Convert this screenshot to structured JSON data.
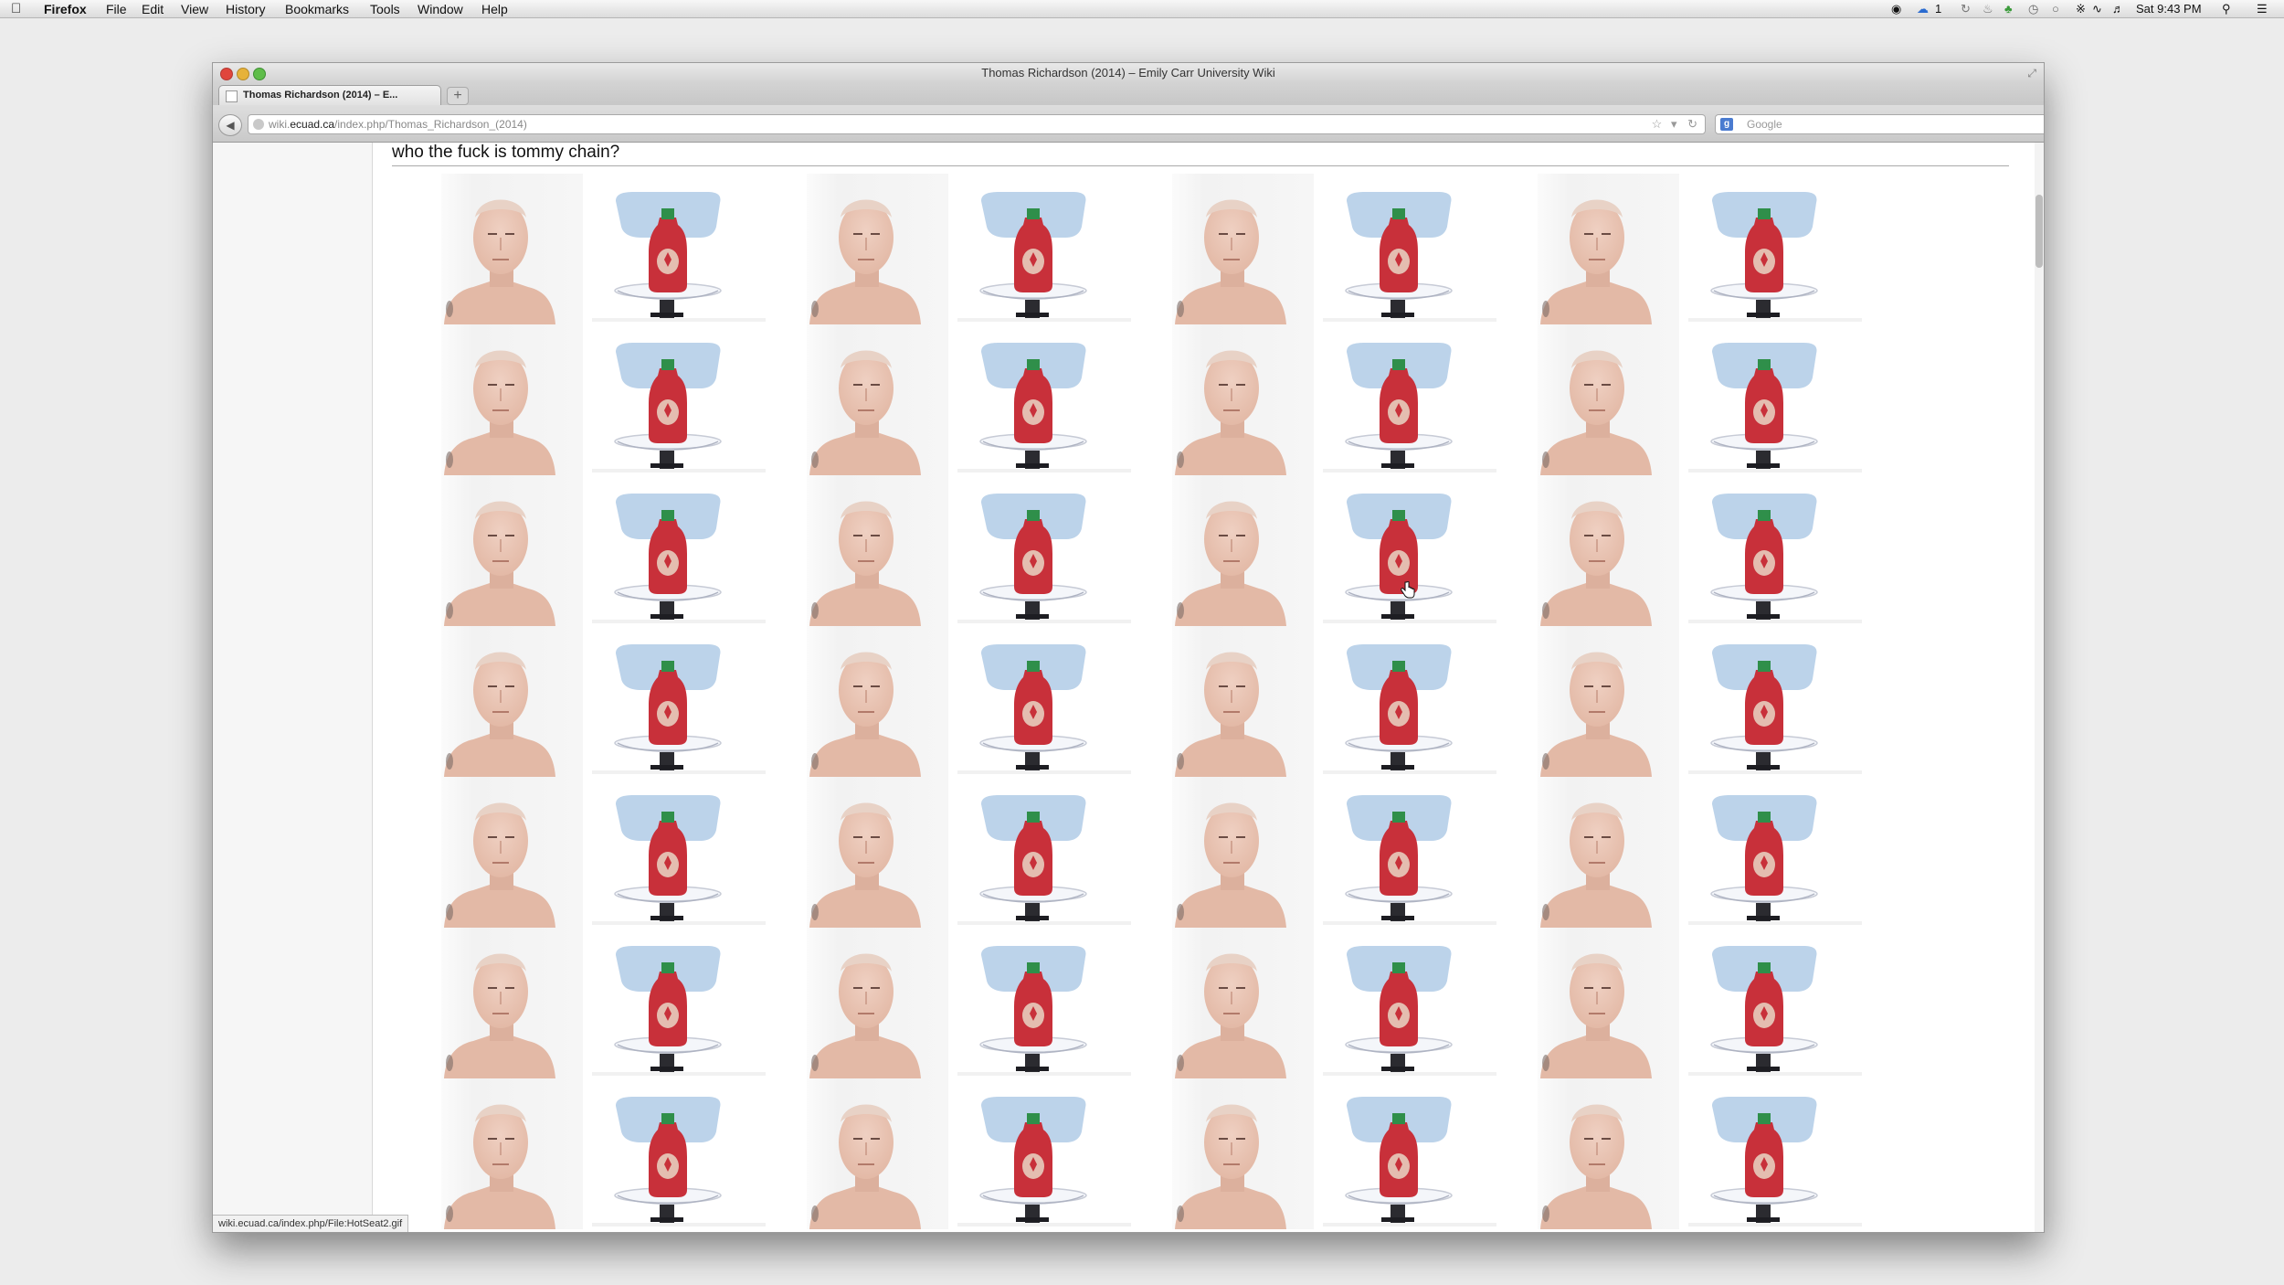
{
  "menubar": {
    "app_name": "Firefox",
    "items": [
      "File",
      "Edit",
      "View",
      "History",
      "Bookmarks",
      "Tools",
      "Window",
      "Help"
    ],
    "badge_count": "1",
    "clock": "Sat 9:43 PM"
  },
  "window": {
    "title": "Thomas Richardson (2014) – Emily Carr University Wiki"
  },
  "tab": {
    "label": "Thomas Richardson (2014) – E..."
  },
  "navbar": {
    "url_prefix": "wiki.",
    "url_host": "ecuad.ca",
    "url_path": "/index.php/Thomas_Richardson_(2014)",
    "search_placeholder": "Google"
  },
  "page": {
    "heading": "who the fuck is tommy chain?",
    "gallery": {
      "columns": 8,
      "rows": 7,
      "pattern": [
        "portrait",
        "hot-sauce-bottle"
      ]
    }
  },
  "status_bar": {
    "link": "wiki.ecuad.ca/index.php/File:HotSeat2.gif"
  },
  "colors": {
    "bottle_red": "#c8303a",
    "cap_green": "#2f8f4a",
    "seat_blue": "#bcd3ea",
    "skin": "#e3b9a6"
  }
}
